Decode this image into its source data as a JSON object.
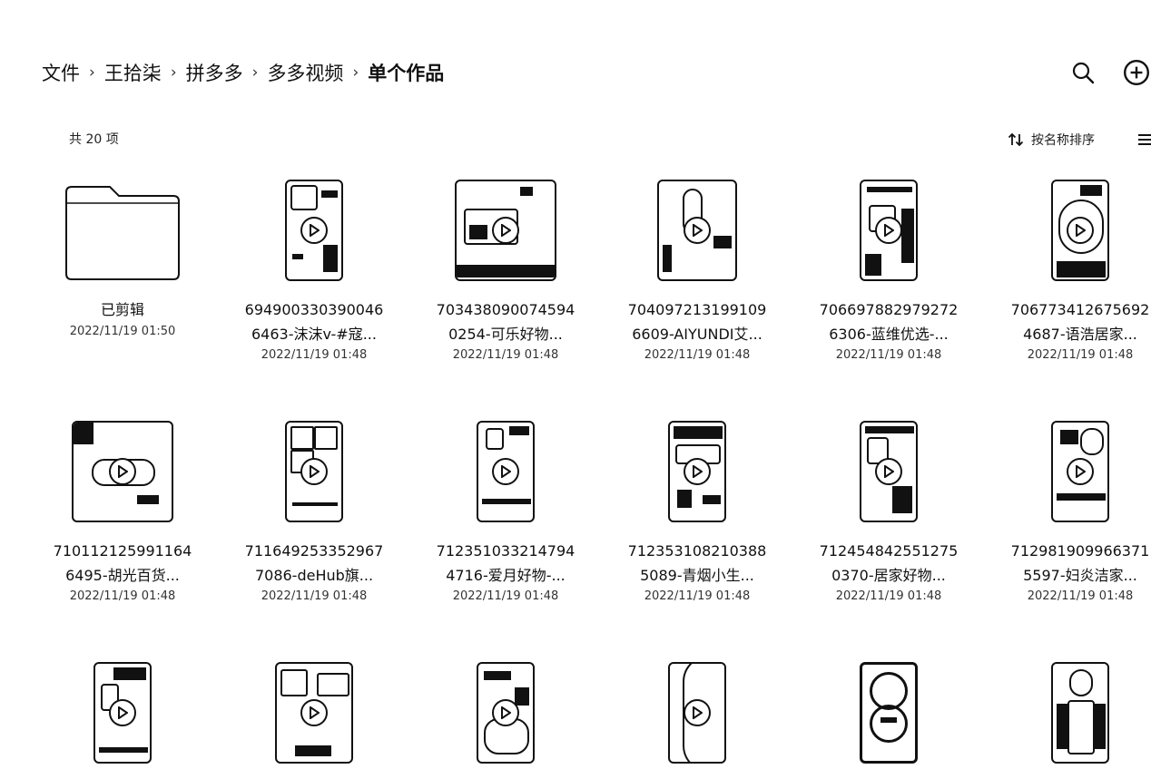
{
  "breadcrumb": {
    "items": [
      "文件",
      "王拾柒",
      "拼多多",
      "多多视频"
    ],
    "current": "单个作品",
    "separator": "›"
  },
  "header": {
    "search_icon": "search-icon",
    "add_icon": "add-circle-icon"
  },
  "toolbar": {
    "count": "共 20 项",
    "sort_label": "按名称排序",
    "sort_icon": "sort-arrows-icon",
    "view_icon": "list-view-icon"
  },
  "items": [
    {
      "type": "folder",
      "name1": "已剪辑",
      "date": "2022/11/19 01:50"
    },
    {
      "type": "video",
      "name1": "694900330390046",
      "name2": "6463-沫沫v-#寇...",
      "date": "2022/11/19 01:48"
    },
    {
      "type": "video",
      "name1": "703438090074594",
      "name2": "0254-可乐好物...",
      "date": "2022/11/19 01:48"
    },
    {
      "type": "video",
      "name1": "704097213199109",
      "name2": "6609-AIYUNDI艾...",
      "date": "2022/11/19 01:48"
    },
    {
      "type": "video",
      "name1": "706697882979272",
      "name2": "6306-蓝维优选-...",
      "date": "2022/11/19 01:48"
    },
    {
      "type": "video",
      "name1": "706773412675692",
      "name2": "4687-语浩居家...",
      "date": "2022/11/19 01:48"
    },
    {
      "type": "video",
      "name1": "710112125991164",
      "name2": "6495-胡光百货...",
      "date": "2022/11/19 01:48"
    },
    {
      "type": "video",
      "name1": "711649253352967",
      "name2": "7086-deHub旗...",
      "date": "2022/11/19 01:48"
    },
    {
      "type": "video",
      "name1": "712351033214794",
      "name2": "4716-爱月好物-...",
      "date": "2022/11/19 01:48"
    },
    {
      "type": "video",
      "name1": "712353108210388",
      "name2": "5089-青烟小生...",
      "date": "2022/11/19 01:48"
    },
    {
      "type": "video",
      "name1": "712454842551275",
      "name2": "0370-居家好物...",
      "date": "2022/11/19 01:48"
    },
    {
      "type": "video",
      "name1": "712981909966371",
      "name2": "5597-妇炎洁家...",
      "date": "2022/11/19 01:48"
    },
    {
      "type": "video"
    },
    {
      "type": "video"
    },
    {
      "type": "video"
    },
    {
      "type": "video"
    },
    {
      "type": "video"
    },
    {
      "type": "video"
    }
  ]
}
